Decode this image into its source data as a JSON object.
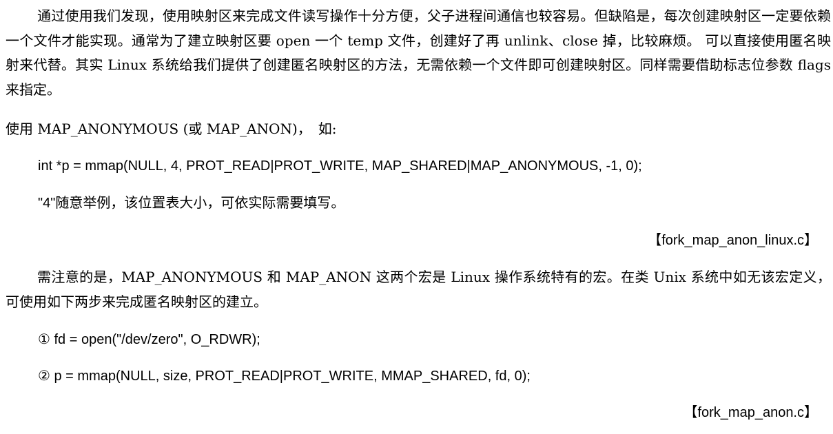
{
  "document": {
    "paragraph_1": "通过使用我们发现，使用映射区来完成文件读写操作十分方便，父子进程间通信也较容易。但缺陷是，每次创建映射区一定要依赖一个文件才能实现。通常为了建立映射区要 open 一个 temp 文件，创建好了再 unlink、close 掉，比较麻烦。 可以直接使用匿名映射来代替。其实 Linux 系统给我们提供了创建匿名映射区的方法，无需依赖一个文件即可创建映射区。同样需要借助标志位参数 flags 来指定。",
    "paragraph_2": "使用 MAP_ANONYMOUS (或 MAP_ANON)，　如:",
    "code_example": "int *p = mmap(NULL, 4, PROT_READ|PROT_WRITE, MAP_SHARED|MAP_ANONYMOUS, -1, 0);",
    "note": "\"4\"随意举例，该位置表大小，可依实际需要填写。",
    "file_ref_1": "【fork_map_anon_linux.c】",
    "paragraph_3": "需注意的是，MAP_ANONYMOUS 和 MAP_ANON 这两个宏是 Linux 操作系统特有的宏。在类 Unix 系统中如无该宏定义，可使用如下两步来完成匿名映射区的建立。",
    "step_1": "①  fd = open(\"/dev/zero\", O_RDWR);",
    "step_2": "②  p = mmap(NULL, size, PROT_READ|PROT_WRITE, MMAP_SHARED, fd, 0);",
    "file_ref_2": "【fork_map_anon.c】"
  }
}
